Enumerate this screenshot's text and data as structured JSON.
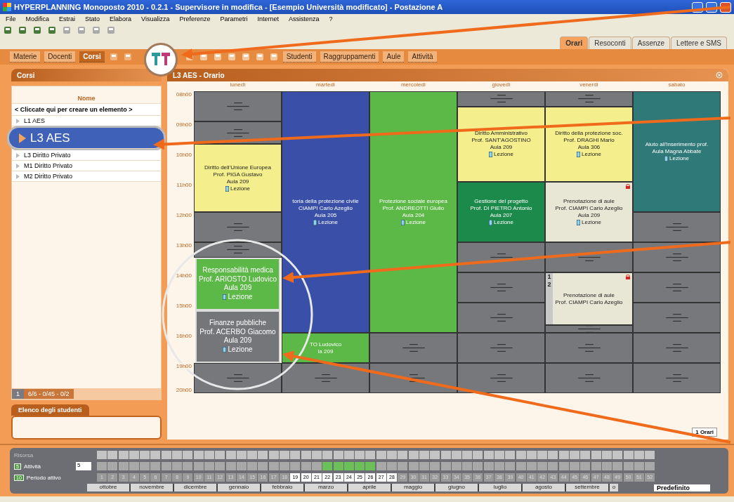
{
  "window": {
    "title": "HYPERPLANNING Monoposto 2010 - 0.2.1 - Supervisore in modifica - [Esempio Università modificato] - Postazione A"
  },
  "menu": [
    "File",
    "Modifica",
    "Estrai",
    "Stato",
    "Elabora",
    "Visualizza",
    "Preferenze",
    "Parametri",
    "Internet",
    "Assistenza",
    "?"
  ],
  "mode_tabs": [
    {
      "label": "Orari",
      "selected": true
    },
    {
      "label": "Resoconti",
      "selected": false
    },
    {
      "label": "Assenze",
      "selected": false
    },
    {
      "label": "Lettere e SMS",
      "selected": false
    }
  ],
  "resource_tabs": [
    {
      "label": "Materie",
      "selected": false
    },
    {
      "label": "Docenti",
      "selected": false
    },
    {
      "label": "Corsi",
      "selected": true
    }
  ],
  "more_tabs": [
    "Studenti",
    "Raggruppamenti",
    "Aule",
    "Attività"
  ],
  "list_panel": {
    "title": "Corsi",
    "column": "Nome",
    "create_hint": "< Cliccate qui per creare un elemento >",
    "items": [
      {
        "label": "L1 AES",
        "selected": false
      },
      {
        "label": "L3 AES",
        "selected": true
      },
      {
        "label": "L3 Diritto Privato",
        "selected": false
      },
      {
        "label": "M1 Diritto Privato",
        "selected": false
      },
      {
        "label": "M2 Diritto Privato",
        "selected": false
      }
    ],
    "page": "1",
    "counter": "6/6 - 0/45 - 0/2"
  },
  "students_panel": {
    "title": "Elenco degli studenti"
  },
  "schedule": {
    "title": "L3 AES - Orario",
    "times": [
      "08h00",
      "09h00",
      "10h00",
      "11h00",
      "12h00",
      "13h00",
      "14h00",
      "15h00",
      "16h00",
      "19h00",
      "20h00"
    ],
    "days": [
      {
        "name": "lunedì",
        "lessons": [
          {
            "title": "Diritto dell'Unione Europea",
            "teacher": "Prof. PIGA Gustavo",
            "room": "Aula 209",
            "type": "Lezione",
            "color": "#f4ee8c",
            "locked": false,
            "magnified": false
          },
          {
            "title": "Responsabilità medica",
            "teacher": "Prof. ARIOSTO Ludovico",
            "room": "Aula 209",
            "type": "Lezione",
            "color": "#5cb847",
            "locked": false,
            "magnified": true
          },
          {
            "title": "Finanze pubbliche",
            "teacher": "Prof. ACERBO Giacomo",
            "room": "Aula 209",
            "type": "Lezione",
            "color": "#75767a",
            "locked": false,
            "magnified": true
          }
        ]
      },
      {
        "name": "martedì",
        "lessons": [
          {
            "title": "toria della protezione civile",
            "teacher": "CIAMPI Carlo Azeglio",
            "room": "Aula 205",
            "type": "Lezione",
            "color": "#3a50a8",
            "locked": false,
            "magnified": false
          },
          {
            "teacher": "TO Ludovico",
            "room": "la 209",
            "color": "#5cb847",
            "locked": false,
            "magnified": false
          }
        ]
      },
      {
        "name": "mercoledì",
        "lessons": [
          {
            "title": "Protezione sociale europea",
            "teacher": "Prof. ANDREOTTI Giulio",
            "room": "Aula 204",
            "type": "Lezione",
            "color": "#5cb847",
            "locked": false,
            "magnified": false
          }
        ]
      },
      {
        "name": "giovedì",
        "lessons": [
          {
            "title": "Diritto Amministrativo",
            "teacher": "Prof. SANT'AGOSTINO",
            "room": "Aula 209",
            "type": "Lezione",
            "color": "#f4ee8c",
            "locked": false,
            "magnified": false
          },
          {
            "title": "Gestione del progetto",
            "teacher": "Prof. DI PIETRO Antonio",
            "room": "Aula 207",
            "type": "Lezione",
            "color": "#1c8a4a",
            "locked": false,
            "magnified": false
          }
        ]
      },
      {
        "name": "venerdì",
        "lessons": [
          {
            "title": "Diritto della protezione soc.",
            "teacher": "Prof. DRAGHI Mario",
            "room": "Aula 306",
            "type": "Lezione",
            "color": "#f4ee8c",
            "locked": false,
            "magnified": false
          },
          {
            "title": "Prenotazione di aule",
            "teacher": "Prof. CIAMPI Carlo Azeglio",
            "room": "Aula 209",
            "type": "Lezione",
            "color": "#e8e6d4",
            "locked": true,
            "magnified": false
          },
          {
            "title": "Prenotazione di aule",
            "teacher": "Prof. CIAMPI Carlo Azeglio",
            "color": "#e8e6d4",
            "locked": true,
            "magnified": false,
            "tags": [
              "1",
              "2"
            ]
          }
        ]
      },
      {
        "name": "sabato",
        "lessons": [
          {
            "title": "Aiuto all'inserimento prof.",
            "teacher": "Aula Magna Abbate",
            "type": "Lezione",
            "color": "#2f7a78",
            "locked": false,
            "magnified": false
          }
        ]
      }
    ],
    "view_button": "1 Orari"
  },
  "timeline": {
    "resource_label": "Risorsa",
    "activity_badge": "5",
    "activity_label": "Attività",
    "activity_value": "5",
    "period_badge": "10",
    "period_label": "Periodo attivo",
    "weeks": [
      {
        "label": "1",
        "active": false,
        "busy": false
      },
      {
        "label": "2",
        "active": false,
        "busy": false
      },
      {
        "label": "3",
        "active": false,
        "busy": false
      },
      {
        "label": "4",
        "active": false,
        "busy": false
      },
      {
        "label": "5",
        "active": false,
        "busy": false
      },
      {
        "label": "6",
        "active": false,
        "busy": false
      },
      {
        "label": "7",
        "active": false,
        "busy": false
      },
      {
        "label": "8",
        "active": false,
        "busy": false
      },
      {
        "label": "9",
        "active": false,
        "busy": false
      },
      {
        "label": "10",
        "active": false,
        "busy": false
      },
      {
        "label": "11",
        "active": false,
        "busy": false
      },
      {
        "label": "12",
        "active": false,
        "busy": false
      },
      {
        "label": "13",
        "active": false,
        "busy": false
      },
      {
        "label": "14",
        "active": false,
        "busy": false
      },
      {
        "label": "15",
        "active": false,
        "busy": false
      },
      {
        "label": "16",
        "active": false,
        "busy": false
      },
      {
        "label": "17",
        "active": false,
        "busy": false
      },
      {
        "label": "18",
        "active": false,
        "busy": false
      },
      {
        "label": "19",
        "active": true,
        "busy": false
      },
      {
        "label": "20",
        "active": true,
        "busy": false
      },
      {
        "label": "21",
        "active": true,
        "busy": false
      },
      {
        "label": "22",
        "active": true,
        "busy": true
      },
      {
        "label": "23",
        "active": true,
        "busy": true
      },
      {
        "label": "24",
        "active": true,
        "busy": true
      },
      {
        "label": "25",
        "active": true,
        "busy": true
      },
      {
        "label": "26",
        "active": true,
        "busy": true
      },
      {
        "label": "27",
        "active": true,
        "busy": false
      },
      {
        "label": "28",
        "active": true,
        "busy": false
      },
      {
        "label": "29",
        "active": false,
        "busy": false
      },
      {
        "label": "30",
        "active": false,
        "busy": false
      },
      {
        "label": "31",
        "active": false,
        "busy": false
      },
      {
        "label": "32",
        "active": false,
        "busy": false
      },
      {
        "label": "33",
        "active": false,
        "busy": false
      },
      {
        "label": "34",
        "active": false,
        "busy": false
      },
      {
        "label": "35",
        "active": false,
        "busy": false
      },
      {
        "label": "36",
        "active": false,
        "busy": false
      },
      {
        "label": "37",
        "active": false,
        "busy": false
      },
      {
        "label": "38",
        "active": false,
        "busy": false
      },
      {
        "label": "39",
        "active": false,
        "busy": false
      },
      {
        "label": "40",
        "active": false,
        "busy": false
      },
      {
        "label": "41",
        "active": false,
        "busy": false
      },
      {
        "label": "42",
        "active": false,
        "busy": false
      },
      {
        "label": "43",
        "active": false,
        "busy": false
      },
      {
        "label": "44",
        "active": false,
        "busy": false
      },
      {
        "label": "45",
        "active": false,
        "busy": false
      },
      {
        "label": "46",
        "active": false,
        "busy": false
      },
      {
        "label": "47",
        "active": false,
        "busy": false
      },
      {
        "label": "48",
        "active": false,
        "busy": false
      },
      {
        "label": "49",
        "active": false,
        "busy": false
      },
      {
        "label": "50",
        "active": false,
        "busy": false
      },
      {
        "label": "51",
        "active": false,
        "busy": false
      },
      {
        "label": "52",
        "active": false,
        "busy": false
      }
    ],
    "months": [
      "ottobre",
      "novembre",
      "dicembre",
      "gennaio",
      "febbraio",
      "marzo",
      "aprile",
      "maggio",
      "giugno",
      "luglio",
      "agosto",
      "settembre",
      "o"
    ],
    "preset": "Predefinito"
  }
}
